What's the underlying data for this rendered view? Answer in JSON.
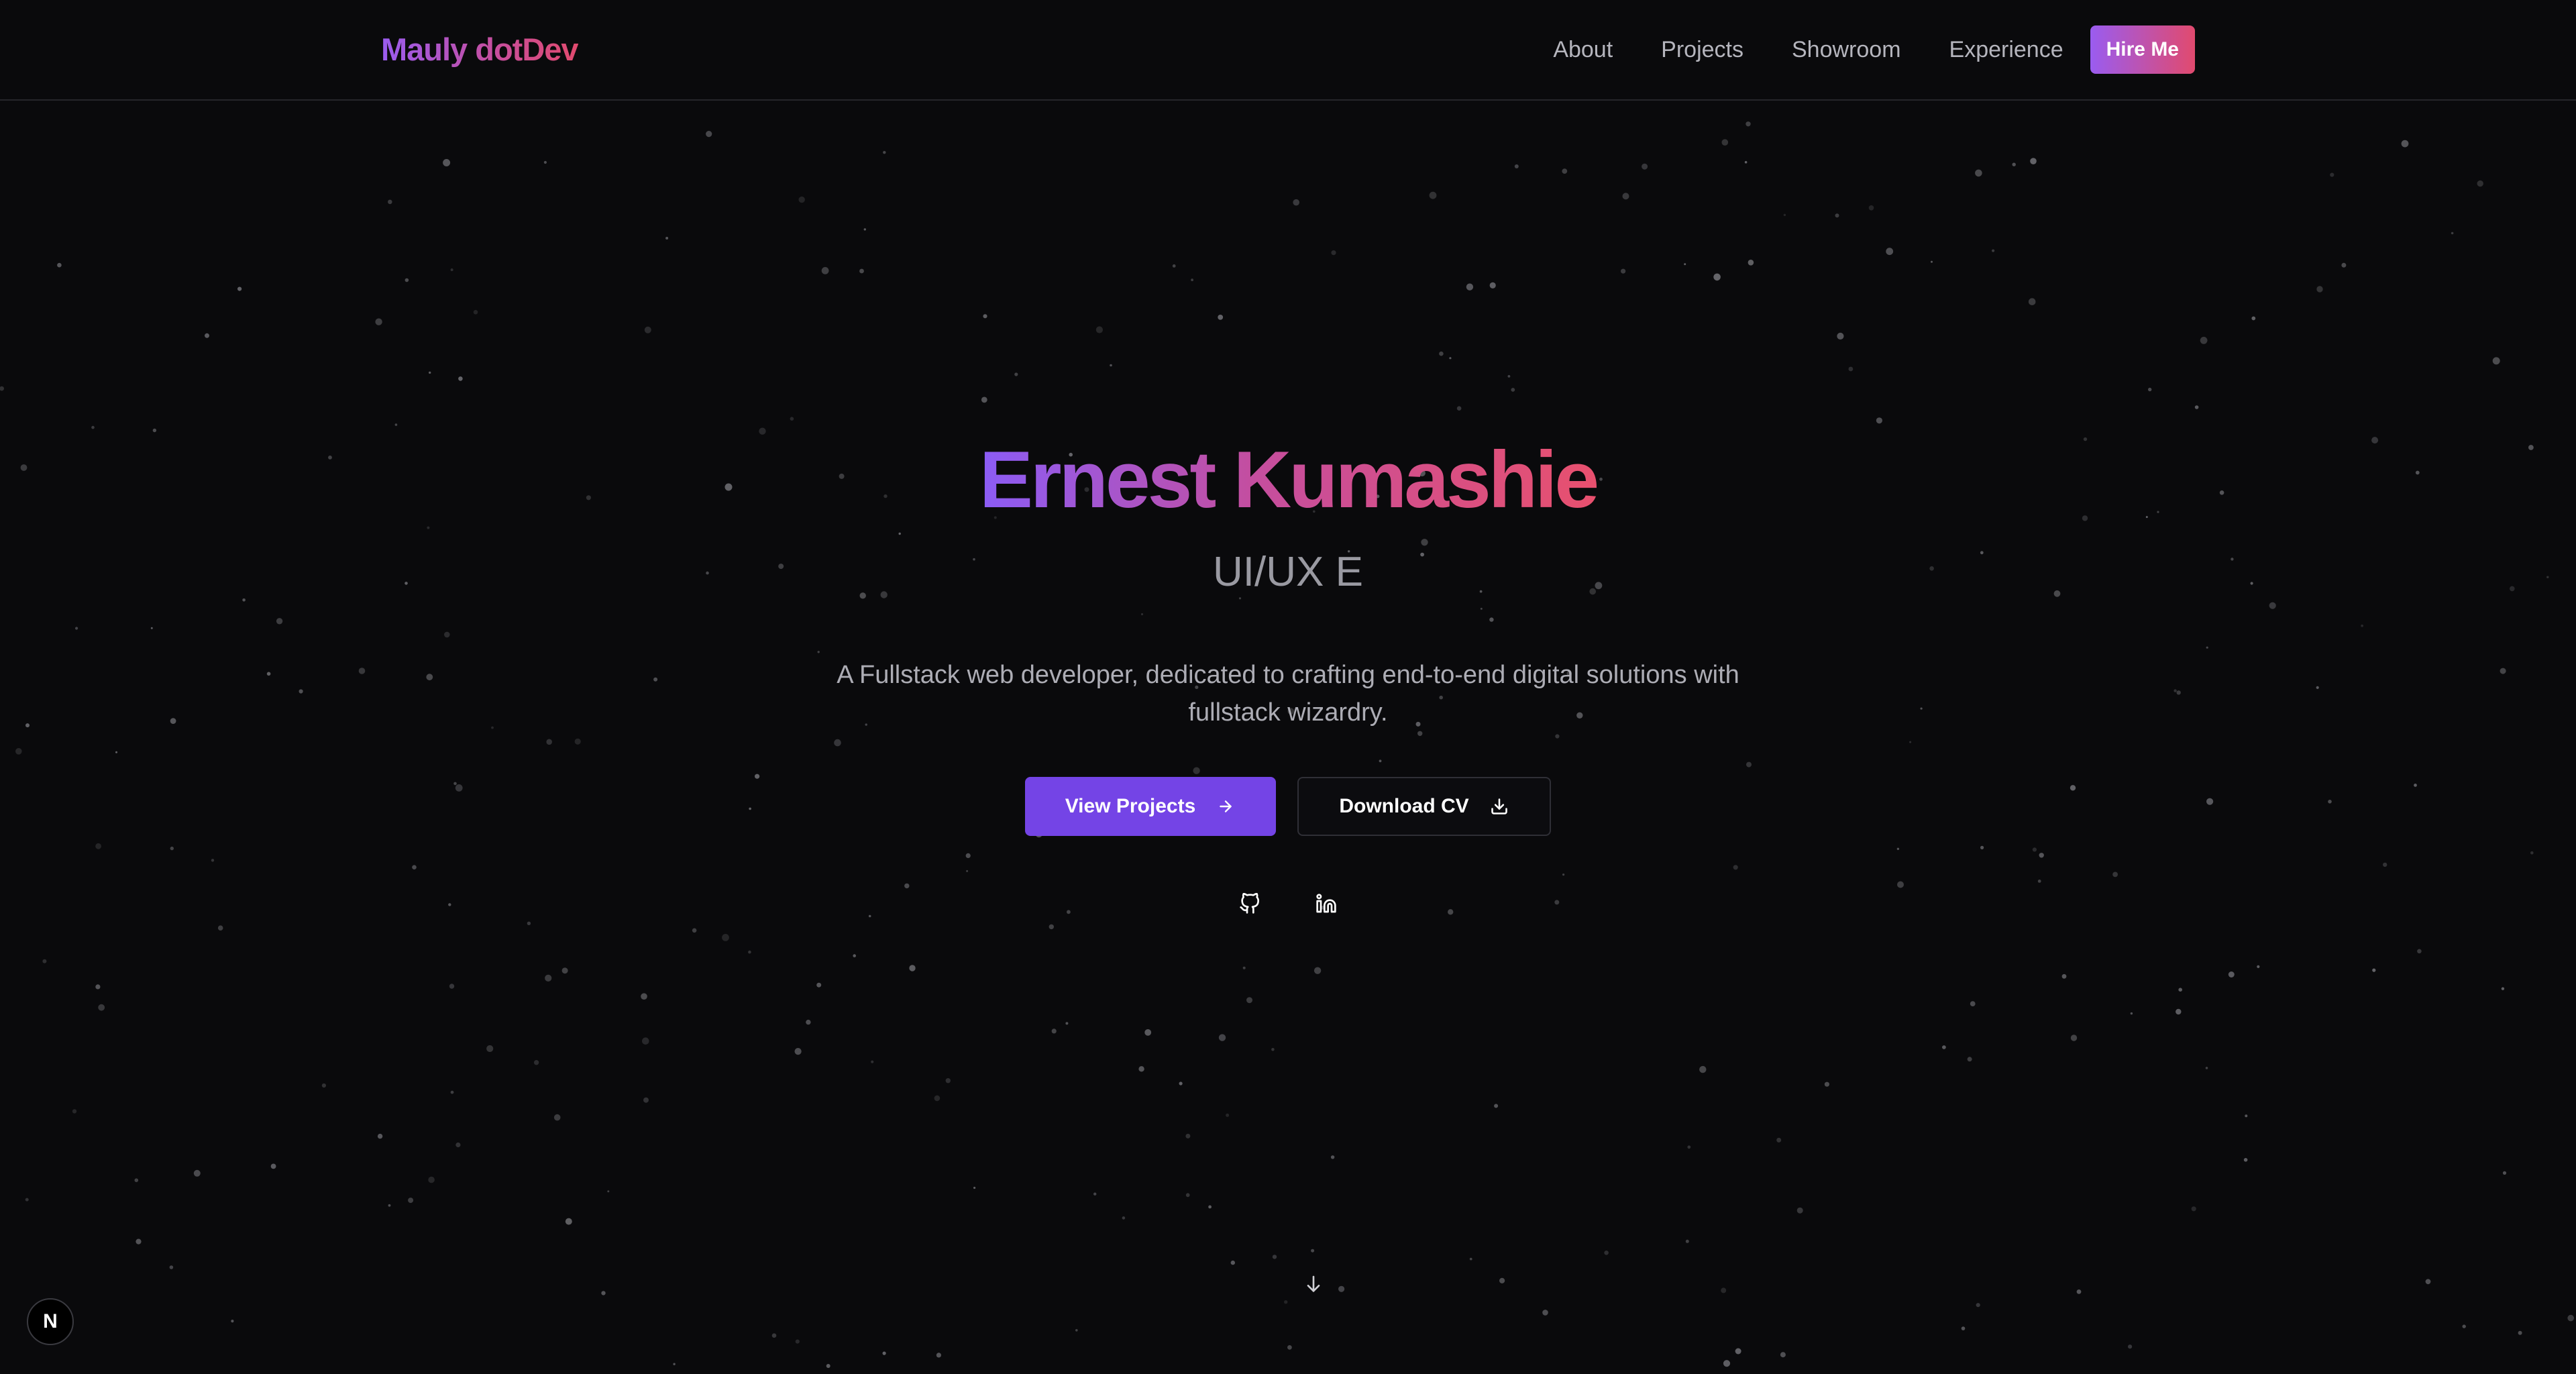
{
  "header": {
    "logo": "Mauly dotDev",
    "nav": {
      "about": "About",
      "projects": "Projects",
      "showroom": "Showroom",
      "experience": "Experience"
    },
    "hire_label": "Hire Me"
  },
  "hero": {
    "name": "Ernest Kumashie",
    "role": "UI/UX E",
    "description": "A Fullstack web developer, dedicated to crafting end-to-end digital solutions with fullstack wizardry.",
    "primary_cta": "View Projects",
    "secondary_cta": "Download CV",
    "social": [
      "github-icon",
      "linkedin-icon"
    ]
  },
  "badge": {
    "letter": "N"
  },
  "colors": {
    "background": "#0a0a0c",
    "accent_purple": "#7444e6",
    "gradient_start": "#8b5cf6",
    "gradient_end": "#e8506e",
    "muted_text": "#adadb5"
  }
}
